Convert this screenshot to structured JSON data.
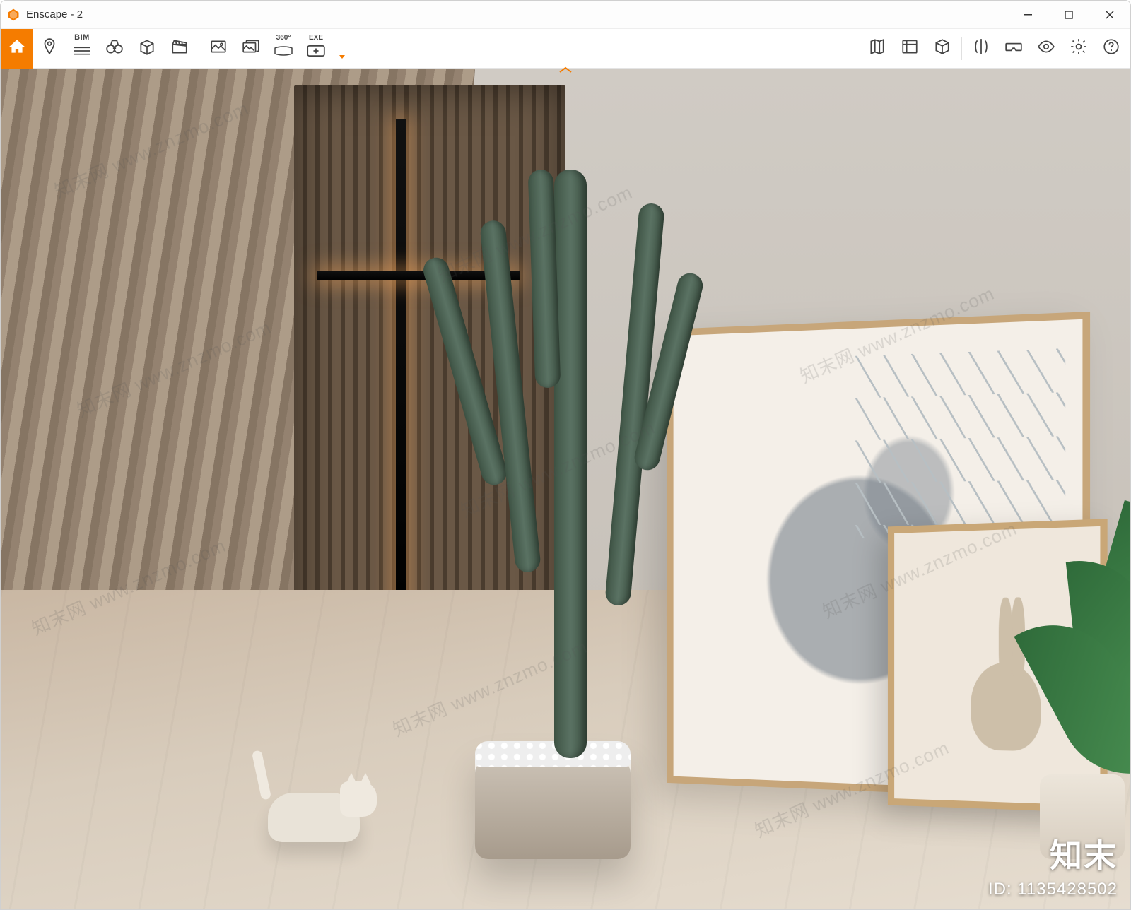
{
  "app": {
    "title": "Enscape - 2",
    "icon_color": "#f57c00"
  },
  "window_controls": {
    "minimize": "minimize",
    "maximize": "maximize",
    "close": "close"
  },
  "toolbar_left": {
    "home": "home",
    "pin": "location-pin",
    "bim_label": "BIM",
    "bim_lines_icon": "bim-lines",
    "binoculars": "binoculars",
    "perspective": "perspective-box",
    "clapper": "clapperboard",
    "sep1": true,
    "screenshot": "screenshot",
    "screenshot_layers": "batch-screenshot",
    "pano_label": "360°",
    "pano_icon": "panorama-360",
    "exe_label": "EXE",
    "exe_icon": "export-exe",
    "more_caret": true
  },
  "toolbar_right": {
    "map": "minimap",
    "assets": "asset-library",
    "cube": "white-mode-cube",
    "compare": "compare-split",
    "vr": "vr-headset",
    "visibility": "eye-visibility",
    "settings": "gear-settings",
    "help": "help"
  },
  "collapse_toggle": "collapse-toolbar",
  "viewport": {
    "scene_desc": "Interior render: wooden floor, beige curtain, vertical slat wall with backlit black cross, large potted saguaro cactus in concrete pot with white pebbles, white ceramic cat figurine, two leaning framed artworks (deer, rabbit), potted broadleaf plant at right."
  },
  "watermark": {
    "line": "知末网 www.znzmo.com"
  },
  "brand": {
    "name": "知末",
    "id_label": "ID: 1135428502"
  }
}
